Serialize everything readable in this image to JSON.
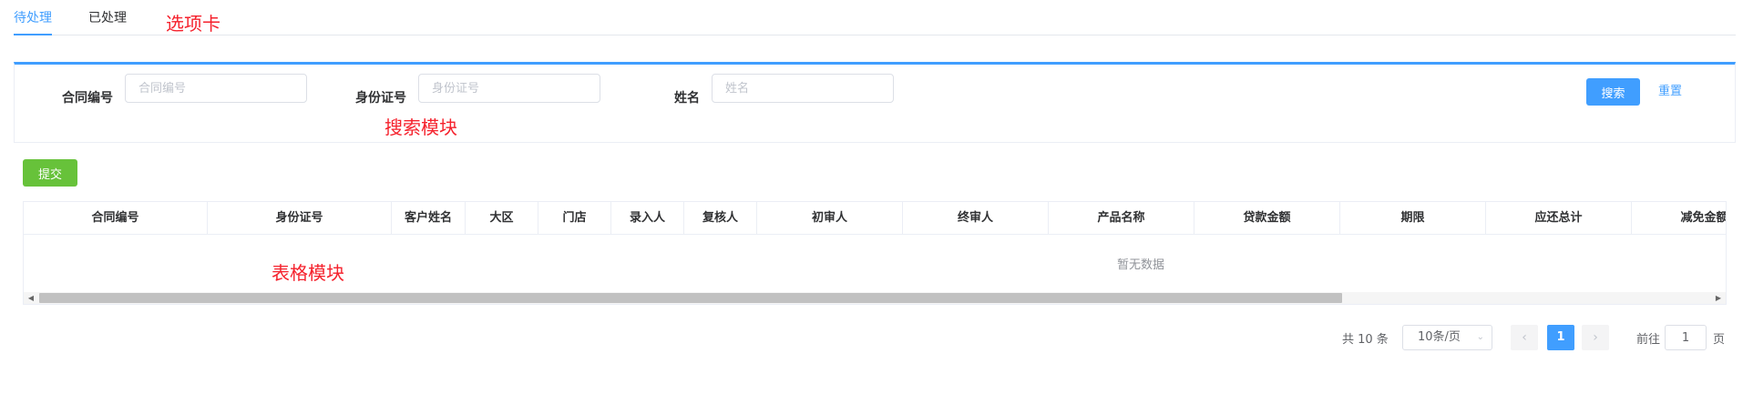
{
  "annotations": {
    "tabs": "选项卡",
    "search": "搜索模块",
    "table": "表格模块"
  },
  "tabs": [
    {
      "label": "待处理",
      "active": true
    },
    {
      "label": "已处理",
      "active": false
    }
  ],
  "search": {
    "contract": {
      "label": "合同编号",
      "placeholder": "合同编号",
      "value": ""
    },
    "id_card": {
      "label": "身份证号",
      "placeholder": "身份证号",
      "value": ""
    },
    "name": {
      "label": "姓名",
      "placeholder": "姓名",
      "value": ""
    },
    "search_label": "搜索",
    "reset_label": "重置"
  },
  "toolbar": {
    "submit_label": "提交"
  },
  "table": {
    "columns": [
      "合同编号",
      "身份证号",
      "客户姓名",
      "大区",
      "门店",
      "录入人",
      "复核人",
      "初审人",
      "终审人",
      "产品名称",
      "贷款金额",
      "期限",
      "应还总计",
      "减免金额"
    ],
    "rows": [],
    "empty_text": "暂无数据"
  },
  "pagination": {
    "total_text": "共 10 条",
    "page_size_text": "10条/页",
    "current_page": "1",
    "goto_label": "前往",
    "goto_value": "1",
    "page_unit": "页"
  },
  "colors": {
    "primary": "#409eff",
    "success": "#67c23a",
    "annotation": "#f5222d"
  },
  "icons": {
    "prev": "chevron-left-icon",
    "next": "chevron-right-icon",
    "dropdown": "chevron-down-icon"
  }
}
